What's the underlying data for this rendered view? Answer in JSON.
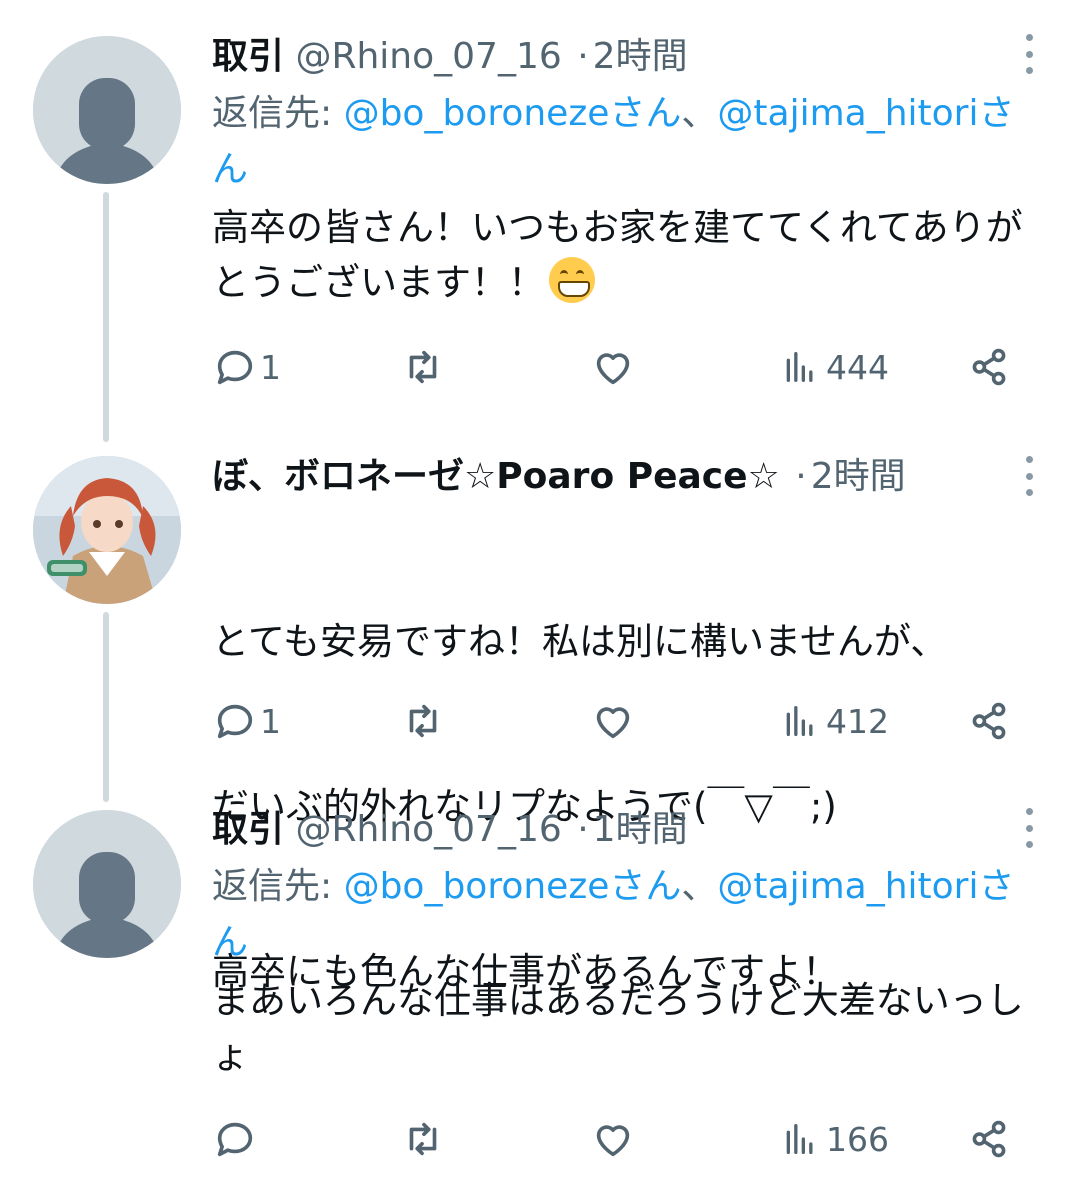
{
  "tweets": [
    {
      "name": "取引",
      "handle": "@Rhino_07_16",
      "dot": "·",
      "time": "2時間",
      "reply_prefix": "返信先: ",
      "reply_user1": "@bo_boronezeさん",
      "reply_sep": "、",
      "reply_user2": "@tajima_hitoriさん",
      "text": "高卒の皆さん！いつもお家を建ててくれてありがとうございます！！",
      "emoji": "grinning-face",
      "replies": "1",
      "views": "444"
    },
    {
      "name": "ぼ、ボロネーゼ☆Poaro Peace☆",
      "dot": "·",
      "time": "2時間",
      "text_line1": "とても安易ですね！私は別に構いませんが、",
      "text_line2": "だいぶ的外れなリプなようで(￣▽￣;)",
      "text_line3": "高卒にも色んな仕事があるんですよ！",
      "replies": "1",
      "views": "412"
    },
    {
      "name": "取引",
      "handle": "@Rhino_07_16",
      "dot": "·",
      "time": "1時間",
      "reply_prefix": "返信先: ",
      "reply_user1": "@bo_boronezeさん",
      "reply_sep": "、",
      "reply_user2": "@tajima_hitoriさん",
      "text": "まあいろんな仕事はあるだろうけど大差ないっしょ",
      "replies": "",
      "views": "166"
    }
  ],
  "colors": {
    "link": "#1d9bf0",
    "secondary": "#536471",
    "thread_line": "#cfd9de"
  },
  "icons": [
    "reply-icon",
    "retweet-icon",
    "like-icon",
    "views-icon",
    "share-icon",
    "more-icon",
    "default-avatar-icon"
  ]
}
